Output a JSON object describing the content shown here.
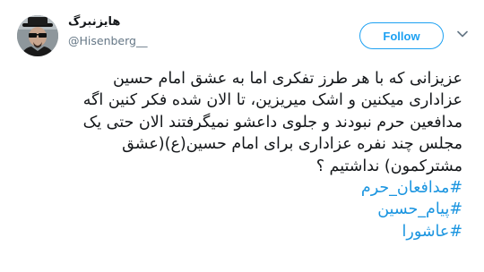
{
  "author": {
    "display_name": "هایزنبرگ",
    "handle": "@Hisenberg__"
  },
  "actions": {
    "follow_label": "Follow",
    "menu_icon": "chevron-down-icon"
  },
  "tweet": {
    "lines": [
      "عزیزانی که با هر طرز تفکری اما به عشق امام حسین",
      "عزاداری میکنین و اشک میریزین، تا الان شده فکر کنین اگه",
      "مدافعین حرم نبودند و جلوی داعشو نمیگرفتند الان حتی یک",
      "مجلس چند نفره عزاداری برای امام حسین(ع)(عشق",
      "مشترکمون) نداشتیم ؟"
    ],
    "hashtags": [
      "#مدافعان_حرم",
      "#پیام_حسین",
      "#عاشورا"
    ]
  },
  "colors": {
    "accent": "#1da1f2",
    "hashtag": "#1b95e0",
    "muted": "#657786"
  }
}
